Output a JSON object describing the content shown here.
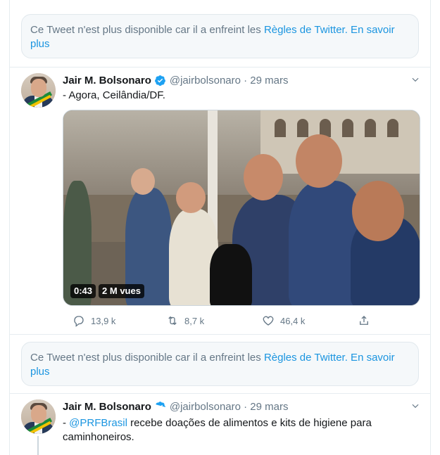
{
  "notices": [
    {
      "text": "Ce Tweet n'est plus disponible car il a enfreint les ",
      "link1": "Règles de Twitter.",
      "link2": " En savoir plus"
    },
    {
      "text": "Ce Tweet n'est plus disponible car il a enfreint les ",
      "link1": "Règles de Twitter.",
      "link2": " En savoir plus"
    }
  ],
  "tweets": [
    {
      "name": "Jair M. Bolsonaro",
      "handle": "@jairbolsonaro · 29 mars",
      "text": "- Agora, Ceilândia/DF.",
      "media": {
        "duration": "0:43",
        "views": "2 M vues"
      },
      "actions": {
        "replies": "13,9 k",
        "retweets": "8,7 k",
        "likes": "46,4 k"
      }
    },
    {
      "name": "Jair M. Bolsonaro",
      "handle": "@jairbolsonaro · 29 mars",
      "text_prefix": "- ",
      "mention": "@PRFBrasil",
      "text_rest": " recebe doações de alimentos e kits de higiene para caminhoneiros."
    }
  ],
  "icons": {
    "verified": "verified-badge-icon",
    "chevron": "chevron-down-icon",
    "reply": "reply-icon",
    "retweet": "retweet-icon",
    "like": "heart-icon",
    "share": "share-icon"
  },
  "colors": {
    "accent": "#1b95e0",
    "muted": "#657786",
    "border": "#e6ecf0",
    "notice_bg": "#f5f8fa"
  }
}
